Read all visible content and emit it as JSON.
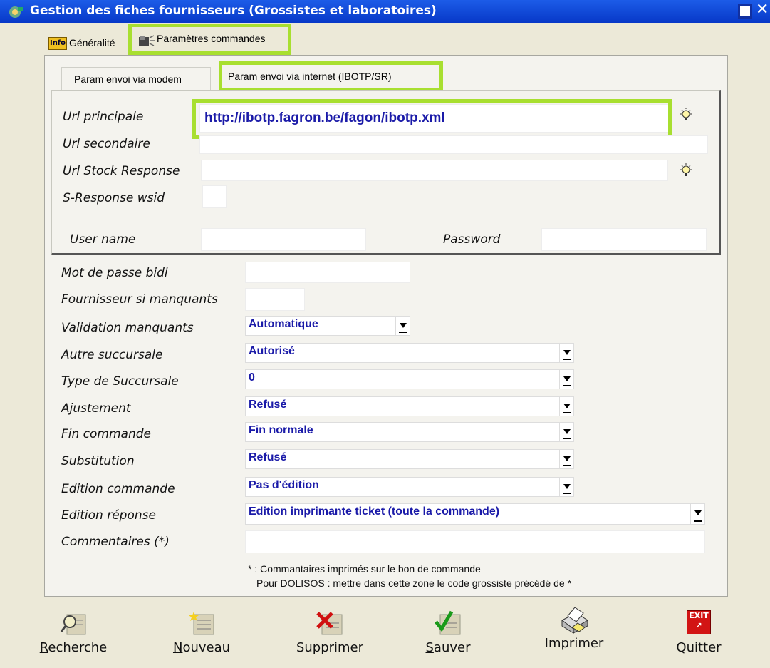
{
  "window": {
    "title": "Gestion des fiches fournisseurs (Grossistes et laboratoires)"
  },
  "tabs": {
    "main": [
      {
        "label": "Généralité",
        "icon": "info-icon"
      },
      {
        "label": "Paramètres commandes",
        "icon": "phone-icon"
      }
    ],
    "sub": [
      {
        "label": "Param envoi  via modem"
      },
      {
        "label": "Param envoi via internet (IBOTP/SR)"
      }
    ]
  },
  "internet": {
    "url_principale_label": "Url principale",
    "url_principale_value": "http://ibotp.fagron.be/fagon/ibotp.xml",
    "url_secondaire_label": "Url secondaire",
    "url_stock_label": "Url Stock Response",
    "sresponse_label": "S-Response wsid",
    "username_label": "User name",
    "password_label": "Password"
  },
  "form": {
    "mot_de_passe_label": "Mot de passe bidi",
    "fournisseur_label": "Fournisseur si manquants",
    "validation_label": "Validation manquants",
    "validation_value": "Automatique",
    "autre_label": "Autre succursale",
    "autre_value": "Autorisé",
    "type_label": "Type de Succursale",
    "type_value": "0",
    "ajustement_label": "Ajustement",
    "ajustement_value": "Refusé",
    "fin_label": "Fin commande",
    "fin_value": "Fin normale",
    "substitution_label": "Substitution",
    "substitution_value": "Refusé",
    "edition_commande_label": "Edition commande",
    "edition_commande_value": "Pas d'édition",
    "edition_reponse_label": "Edition réponse",
    "edition_reponse_value": "Edition imprimante ticket (toute la commande)",
    "commentaires_label": "Commentaires (*)",
    "note_line1": "* : Commantaires imprimés sur le bon de commande",
    "note_line2": "Pour DOLISOS : mettre dans cette zone le code grossiste précédé de *"
  },
  "toolbar": {
    "recherche": {
      "label": "Recherche",
      "key": "R",
      "rest": "echerche"
    },
    "nouveau": {
      "label": "Nouveau",
      "key": "N",
      "rest": "ouveau"
    },
    "supprimer": {
      "label": "Supprimer"
    },
    "sauver": {
      "label": "Sauver",
      "key": "S",
      "rest": "auver"
    },
    "imprimer": {
      "label": "Imprimer"
    },
    "quitter": {
      "label": "Quitter"
    }
  },
  "colors": {
    "highlight": "#a8df30",
    "value_text": "#1a1aa8",
    "titlebar": "#0a46d6"
  }
}
